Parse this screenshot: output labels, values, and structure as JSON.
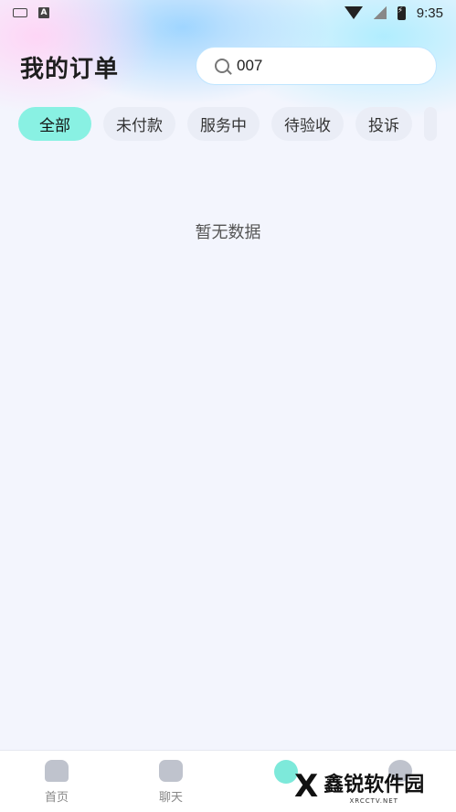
{
  "statusbar": {
    "time": "9:35",
    "keyboard_icon": "keyboard-icon",
    "a_icon_label": "A"
  },
  "header": {
    "title": "我的订单"
  },
  "search": {
    "value": "007",
    "icon": "search-icon"
  },
  "tabs": [
    {
      "label": "全部",
      "active": true
    },
    {
      "label": "未付款"
    },
    {
      "label": "服务中"
    },
    {
      "label": "待验收"
    },
    {
      "label": "投诉"
    }
  ],
  "empty": {
    "text": "暂无数据"
  },
  "bottom_nav": {
    "items": [
      {
        "label": "首页",
        "icon": "home-icon"
      },
      {
        "label": "聊天",
        "icon": "chat-icon"
      },
      {
        "label": "",
        "icon": "order-icon"
      },
      {
        "label": "",
        "icon": "profile-icon"
      }
    ]
  },
  "watermark": {
    "logo": "X",
    "title": "鑫锐软件园",
    "sub": "XRCCTV.NET"
  },
  "colors": {
    "accent": "#89f1e3",
    "background": "#f3f5fd"
  }
}
